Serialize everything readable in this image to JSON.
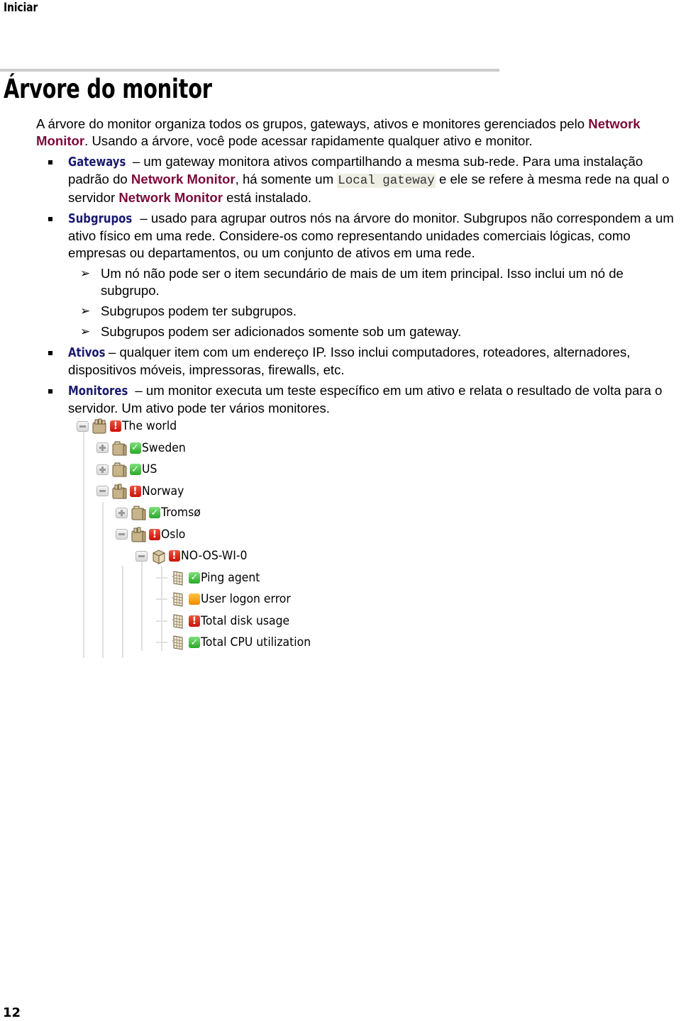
{
  "header": {
    "section": "Iniciar"
  },
  "title": "Árvore do monitor",
  "intro": {
    "before": "A árvore do monitor organiza todos os grupos, gateways, ativos e monitores gerenciados pelo ",
    "product": "Network Monitor",
    "after": ". Usando a árvore, você pode acessar rapidamente qualquer ativo e monitor."
  },
  "bullets": [
    {
      "term": "Gateways",
      "t1": " – um gateway monitora ativos compartilhando a mesma sub-rede. Para uma instalação padrão do ",
      "p1": "Network Monitor",
      "t2": ", há somente um ",
      "code": "Local gateway",
      "t3": " e ele se refere à mesma rede na qual o servidor ",
      "p2": "Network Monitor",
      "t4": " está instalado."
    },
    {
      "term": "Subgrupos",
      "text": " – usado para agrupar outros nós na árvore do monitor. Subgrupos não correspondem a um ativo físico em uma rede. Considere-os como representando unidades comerciais lógicas, como empresas ou departamentos, ou um conjunto de ativos em uma rede.",
      "subitems": [
        "Um nó não pode ser o item secundário de mais de um item principal. Isso inclui um nó de subgrupo.",
        "Subgrupos podem ter subgrupos.",
        "Subgrupos podem ser adicionados somente sob um gateway."
      ]
    },
    {
      "term": "Ativos",
      "text": " – qualquer item com um endereço IP. Isso inclui computadores, roteadores, alternadores, dispositivos móveis, impressoras, firewalls, etc."
    },
    {
      "term": "Monitores",
      "text": " – um monitor executa um teste específico em um ativo e relata o resultado de volta para o servidor. Um ativo pode ter vários monitores."
    }
  ],
  "tree": {
    "nodes": [
      {
        "label": "The world",
        "toggle": "collapse",
        "icon": "gateway-icon",
        "status": "error",
        "level": 0
      },
      {
        "label": "Sweden",
        "toggle": "expand",
        "icon": "folder-icon",
        "status": "ok",
        "level": 1
      },
      {
        "label": "US",
        "toggle": "expand",
        "icon": "folder-icon",
        "status": "ok",
        "level": 1
      },
      {
        "label": "Norway",
        "toggle": "collapse",
        "icon": "folder-open-icon",
        "status": "error",
        "level": 1
      },
      {
        "label": "Tromsø",
        "toggle": "expand",
        "icon": "folder-icon",
        "status": "ok",
        "level": 2
      },
      {
        "label": "Oslo",
        "toggle": "collapse",
        "icon": "folder-open-icon",
        "status": "error",
        "level": 2
      },
      {
        "label": "NO-OS-WI-0",
        "toggle": "collapse",
        "icon": "asset-box-icon",
        "status": "error",
        "level": 3
      },
      {
        "label": "Ping agent",
        "toggle": "none",
        "icon": "monitor-icon",
        "status": "ok",
        "level": 4
      },
      {
        "label": "User logon error",
        "toggle": "none",
        "icon": "monitor-icon",
        "status": "warning",
        "level": 4
      },
      {
        "label": "Total disk usage",
        "toggle": "none",
        "icon": "monitor-icon",
        "status": "error",
        "level": 4
      },
      {
        "label": "Total CPU utilization",
        "toggle": "none",
        "icon": "monitor-icon",
        "status": "ok",
        "level": 4
      }
    ]
  },
  "footer": {
    "page_number": "12"
  },
  "colors": {
    "product": "#7a0a3a",
    "term": "#1a1a70",
    "rule": "#cccccc",
    "code_bg": "#eeeee4"
  }
}
